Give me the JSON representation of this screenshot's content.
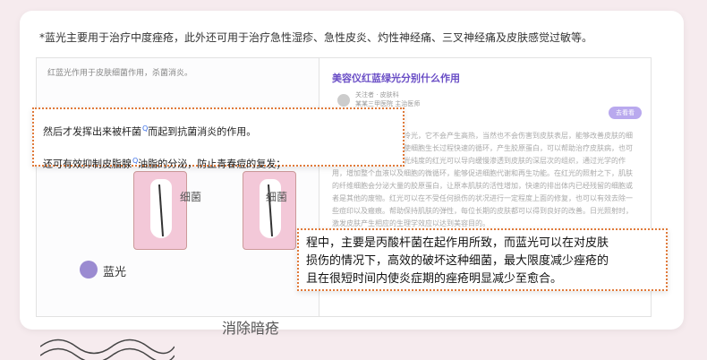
{
  "intro": "*蓝光主要用于治疗中度痤疮，此外还可用于治疗急性湿疹、急性皮炎、灼性神经痛、三叉神经痛及皮肤感觉过敏等。",
  "left_panel": {
    "caption": "红蓝光作用于皮肤细菌作用，杀菌消炎。",
    "cell_label_1": "细菌",
    "cell_label_2": "细菌",
    "blue_label": "蓝光",
    "big_caption": "消除暗疮"
  },
  "right_panel": {
    "title": "美容仪红蓝绿光分别什么作用",
    "meta_line1": "关注者 · 皮肤科",
    "meta_line2": "某某三甲医院 主治医师",
    "follow_button": "去看看",
    "body": "红光和蓝光其实是一种冷光，它不会产生高热，当然也不会伤害到皮肤表层，能够改善皮肤的细胞的内能量的原理，来使细胞生长过程快速的循环，产生胶原蛋白，可以帮助治疗皮肤病，也可以防止老化、抗皱等。光纯度的红光可以导向缓慢渗透到皮肤的深层次的组织，通过光学的作用，增加整个血液以及细胞的微循环，能够促进细胞代谢和再生功能。在红光的照射之下，肌肤的纤维细胞会分泌大量的胶原蛋白，让原本肌肤的活性增加，快速的排出体内已经残留的细胞或者是其他的废物。红光可以在不受任何损伤的状况进行一定程度上面的修复，也可以有效去除一些痘印以及瘢痕。帮助保持肌肤的弹性，每位长期的皮肤都可以得到良好的改善。日光照射时，激发皮肤产生相应的生理学效应以达到美容目的。"
  },
  "highlight_top": {
    "line1": "然后才发挥出来被杆菌",
    "line1_tail": "而起到抗菌消炎的作用。",
    "line2": "还可有效抑制皮脂腺",
    "line2_tail": "油脂的分泌，防止青春痘的复发；",
    "search_glyph": "Q"
  },
  "highlight_bottom": {
    "line1": "程中，主要是丙酸杆菌在起作用所致，而蓝光可以在对皮肤",
    "line2": "损伤的情况下，高效的破坏这种细菌，最大限度减少痤疮的",
    "line3": "且在很短时间内使炎症期的痤疮明显减少至愈合。"
  }
}
